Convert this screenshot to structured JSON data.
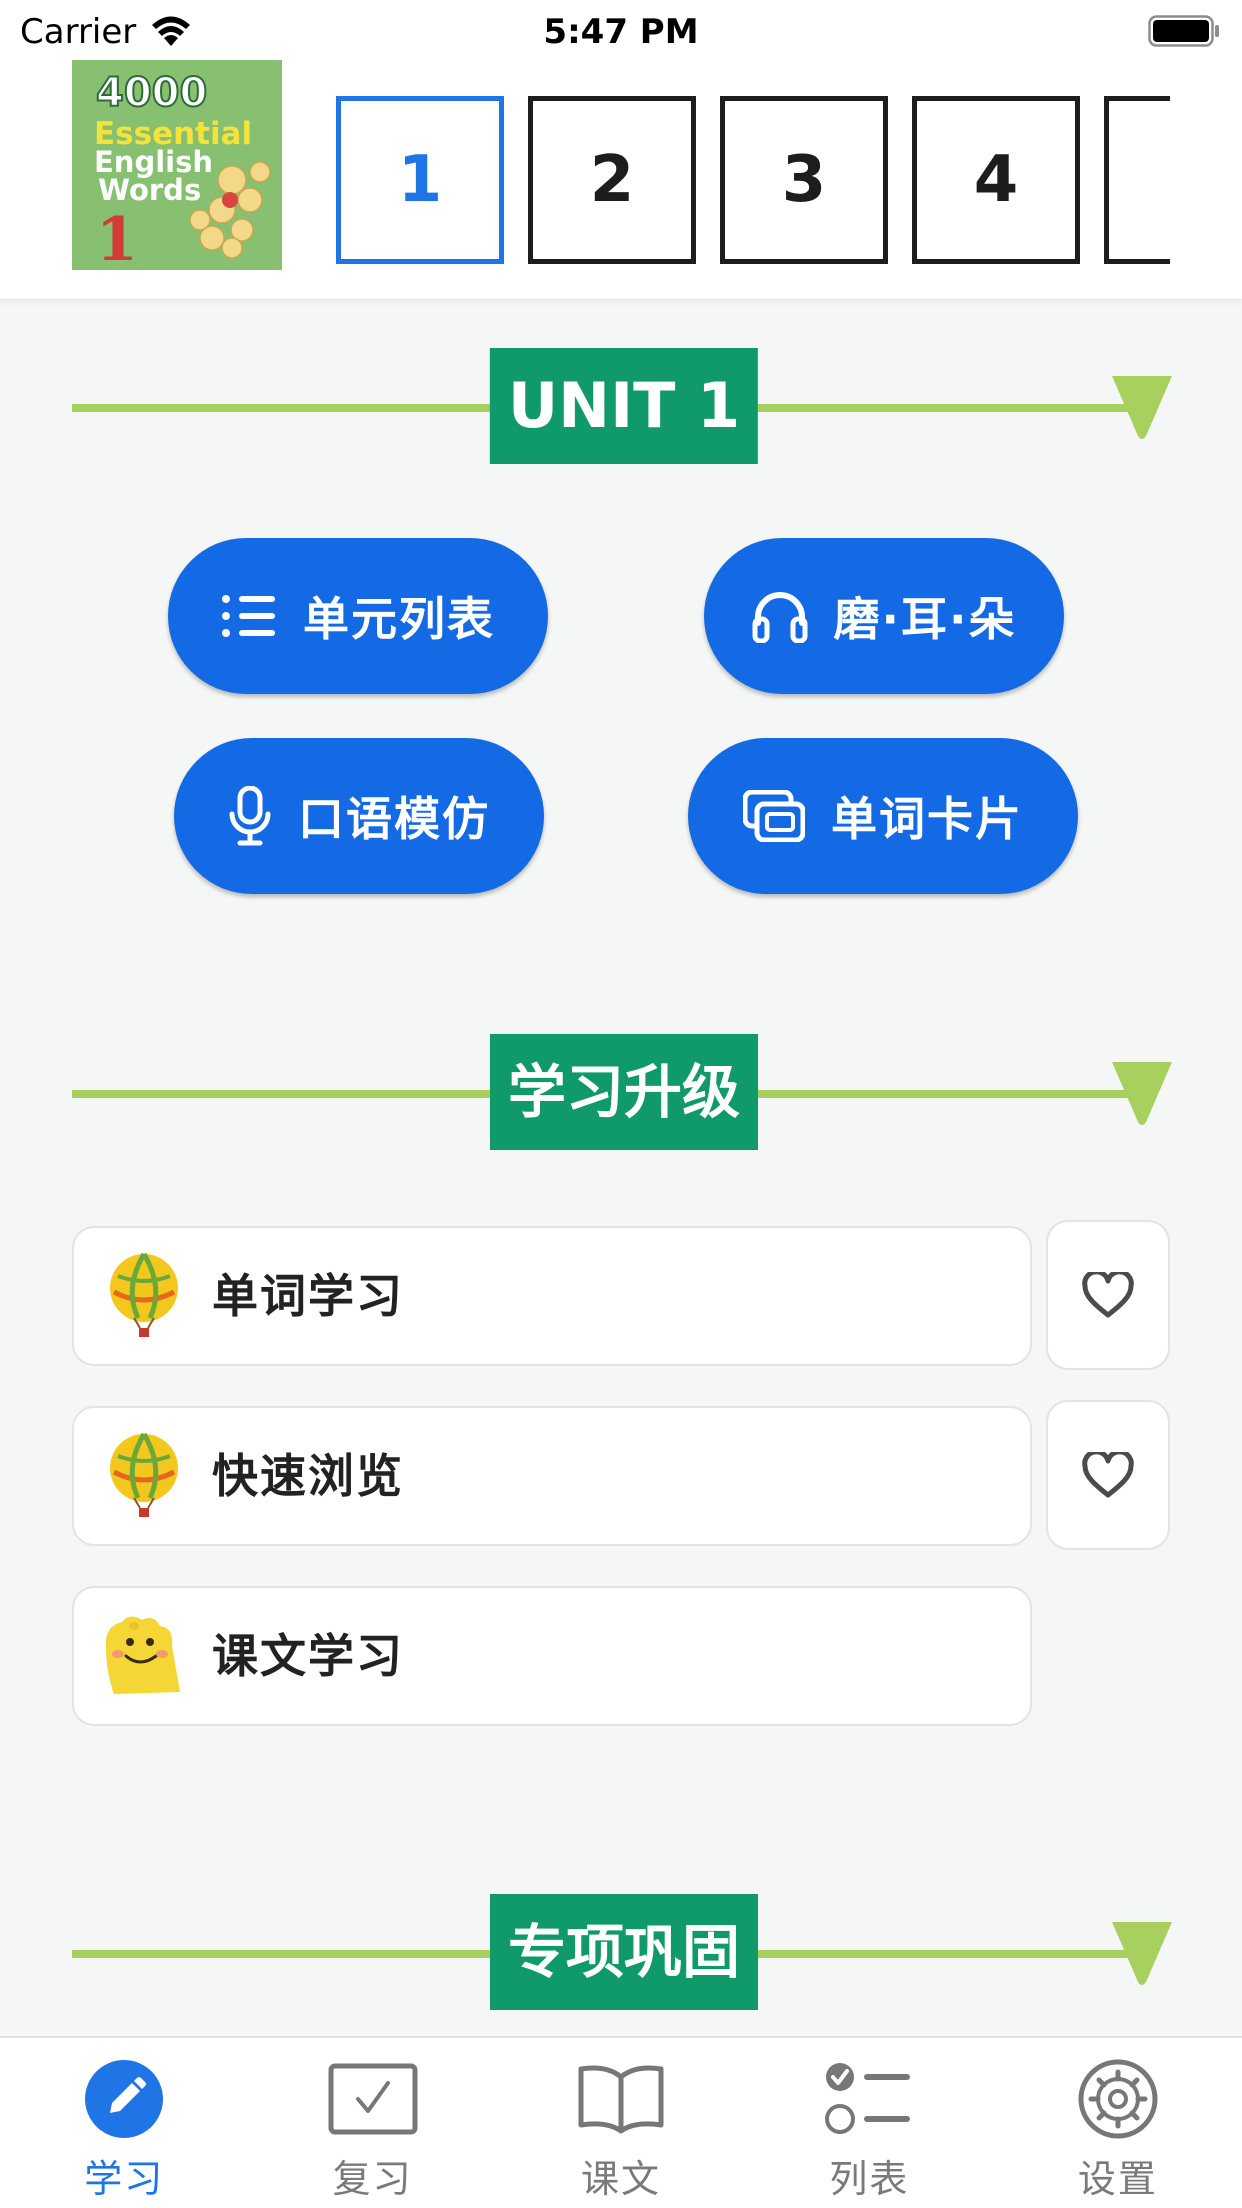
{
  "status_bar": {
    "carrier": "Carrier",
    "time": "5:47 PM"
  },
  "book_cover": {
    "line1": "4000",
    "line2": "Essential",
    "line3": "English",
    "line4": "Words",
    "number": "1"
  },
  "unit_selector": {
    "items": [
      "1",
      "2",
      "3",
      "4"
    ],
    "active_index": 0
  },
  "sections": {
    "unit": "UNIT 1",
    "upgrade": "学习升级",
    "special": "专项巩固"
  },
  "actions": {
    "unit_list": "单元列表",
    "ears": "磨·耳·朵",
    "speaking": "口语模仿",
    "flashcards": "单词卡片"
  },
  "study_items": [
    {
      "label": "单词学习",
      "icon": "hot-air-balloon-icon",
      "favorite": true
    },
    {
      "label": "快速浏览",
      "icon": "hot-air-balloon-icon",
      "favorite": true
    },
    {
      "label": "课文学习",
      "icon": "smiley-paw-icon",
      "favorite": false
    }
  ],
  "tabbar": {
    "items": [
      {
        "label": "学习",
        "icon": "pencil-icon"
      },
      {
        "label": "复习",
        "icon": "checkbox-icon"
      },
      {
        "label": "课文",
        "icon": "book-icon"
      },
      {
        "label": "列表",
        "icon": "checklist-icon"
      },
      {
        "label": "设置",
        "icon": "gear-icon"
      }
    ],
    "active_index": 0
  },
  "colors": {
    "primary_blue": "#1469e5",
    "section_green": "#109a6a",
    "line_green": "#a8d05e",
    "active_tab": "#1f74e6"
  }
}
